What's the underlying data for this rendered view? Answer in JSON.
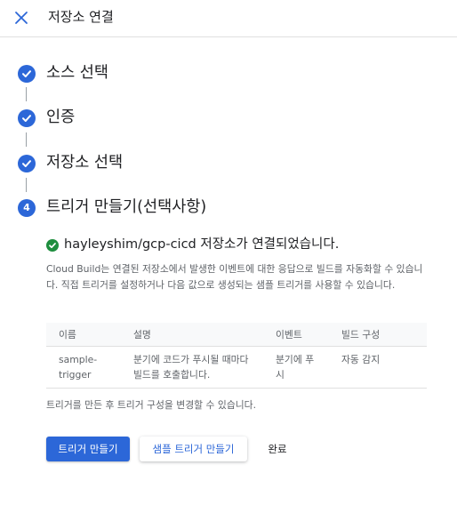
{
  "header": {
    "title": "저장소 연결",
    "close_icon": "close-icon"
  },
  "colors": {
    "accent": "#2c67d8",
    "success": "#1e8e3e",
    "muted_text": "#5f6368"
  },
  "steps": [
    {
      "label": "소스 선택",
      "state": "done"
    },
    {
      "label": "인증",
      "state": "done"
    },
    {
      "label": "저장소 선택",
      "state": "done"
    },
    {
      "label": "트리거 만들기(선택사항)",
      "state": "active",
      "number": "4"
    }
  ],
  "content": {
    "success_message": "hayleyshim/gcp-cicd 저장소가 연결되었습니다.",
    "description": "Cloud Build는 연결된 저장소에서 발생한 이벤트에 대한 응답으로 빌드를 자동화할 수 있습니다. 직접 트리거를 설정하거나 다음 값으로 생성되는 샘플 트리거를 사용할 수 있습니다.",
    "table": {
      "headers": [
        "이름",
        "설명",
        "이벤트",
        "빌드 구성"
      ],
      "rows": [
        [
          "sample-trigger",
          "분기에 코드가 푸시될 때마다 빌드를 호출합니다.",
          "분기에 푸시",
          "자동 감지"
        ]
      ]
    },
    "after_note": "트리거를 만든 후 트리거 구성을 변경할 수 있습니다."
  },
  "actions": {
    "create_trigger": "트리거 만들기",
    "create_sample_trigger": "샘플 트리거 만들기",
    "done": "완료"
  }
}
